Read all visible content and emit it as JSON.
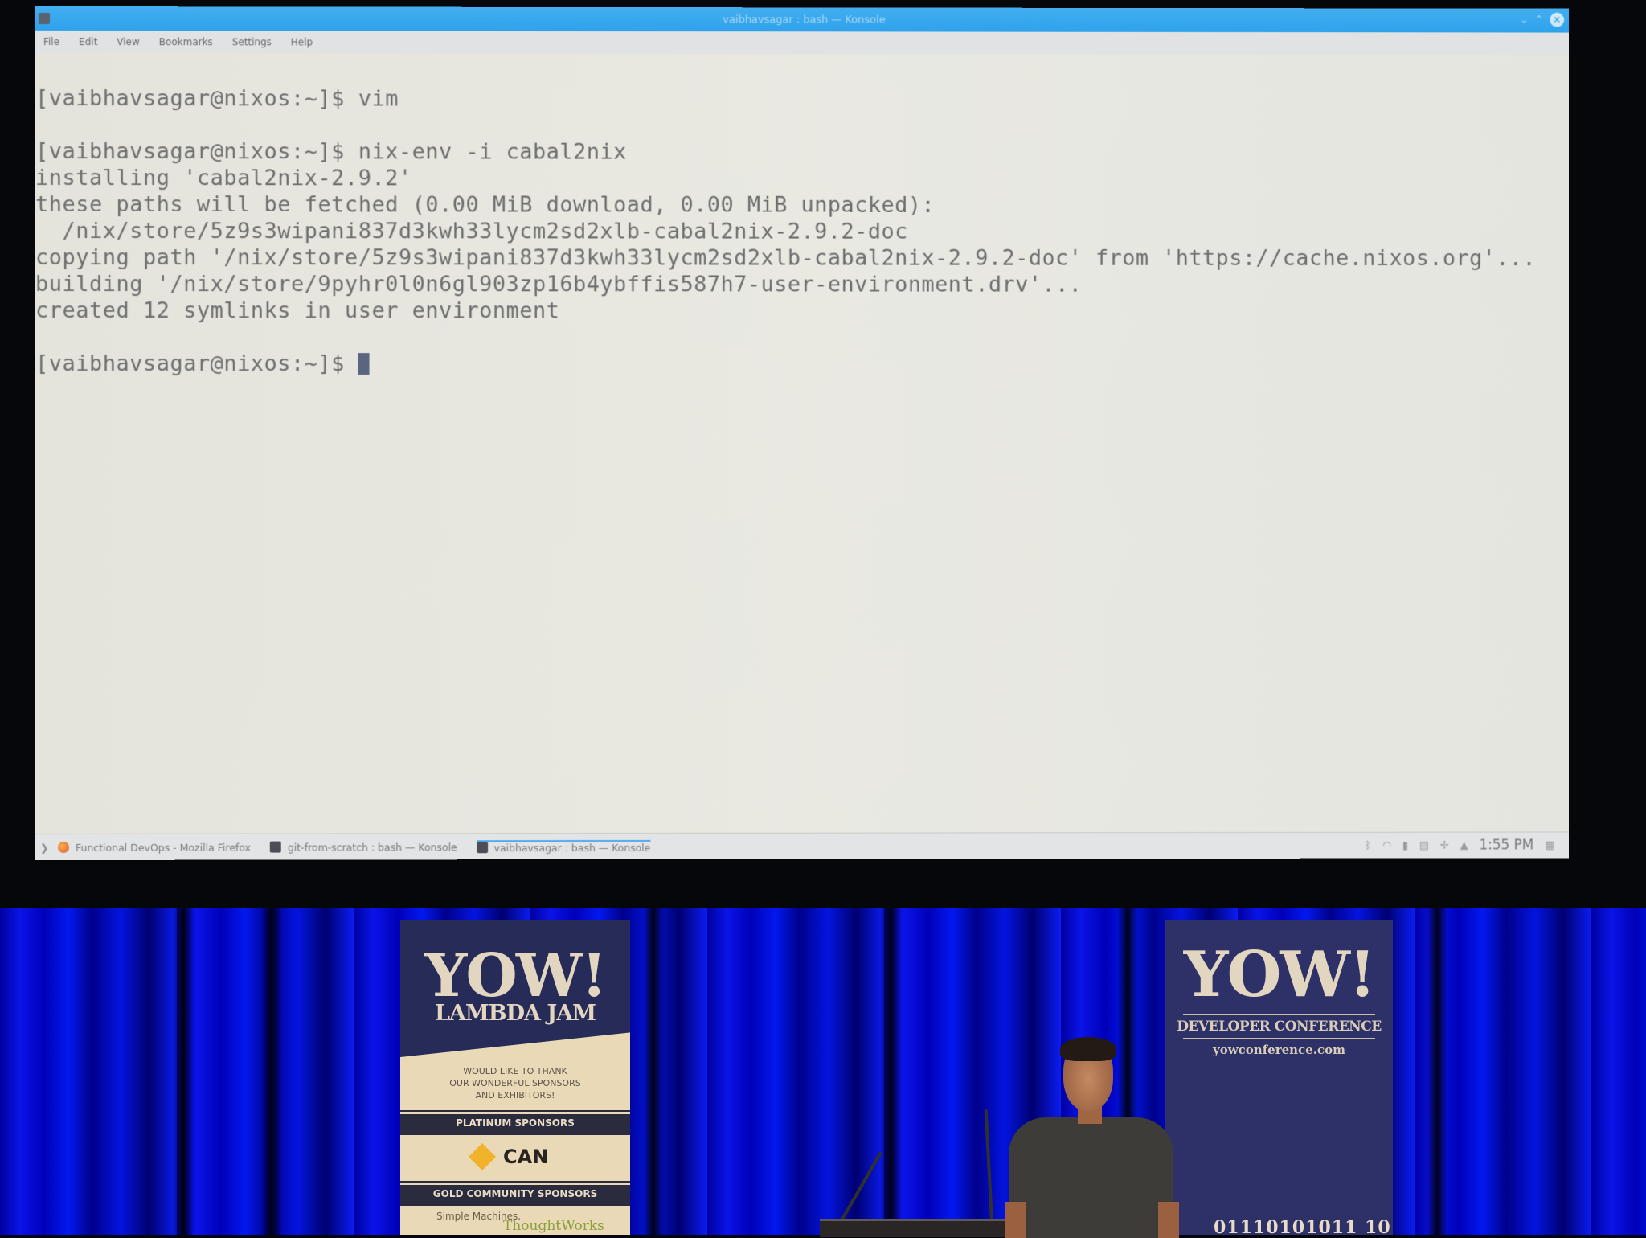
{
  "window": {
    "title": "vaibhavsagar : bash — Konsole",
    "controls": {
      "minimize": "⌄",
      "maximize": "⌃",
      "close": "✕"
    }
  },
  "menubar": {
    "items": [
      {
        "label": "File"
      },
      {
        "label": "Edit"
      },
      {
        "label": "View"
      },
      {
        "label": "Bookmarks"
      },
      {
        "label": "Settings"
      },
      {
        "label": "Help"
      }
    ]
  },
  "terminal": {
    "lines": [
      "[vaibhavsagar@nixos:~]$ vim",
      "",
      "[vaibhavsagar@nixos:~]$ nix-env -i cabal2nix",
      "installing 'cabal2nix-2.9.2'",
      "these paths will be fetched (0.00 MiB download, 0.00 MiB unpacked):",
      "  /nix/store/5z9s3wipani837d3kwh33lycm2sd2xlb-cabal2nix-2.9.2-doc",
      "copying path '/nix/store/5z9s3wipani837d3kwh33lycm2sd2xlb-cabal2nix-2.9.2-doc' from 'https://cache.nixos.org'...",
      "building '/nix/store/9pyhr0l0n6gl903zp16b4ybffis587h7-user-environment.drv'...",
      "created 12 symlinks in user environment",
      "",
      "[vaibhavsagar@nixos:~]$ "
    ]
  },
  "taskbar": {
    "launcher_icon": "application-launcher-icon",
    "tasks": [
      {
        "label": "Functional DevOps - Mozilla Firefox",
        "icon": "firefox-icon",
        "active": false
      },
      {
        "label": "git-from-scratch : bash — Konsole",
        "icon": "konsole-icon",
        "active": false
      },
      {
        "label": "vaibhavsagar : bash — Konsole",
        "icon": "konsole-icon",
        "active": true
      }
    ],
    "tray": {
      "icons": [
        "bluetooth-icon",
        "wifi-icon",
        "battery-icon",
        "clipboard-icon",
        "volume-icon",
        "expand-tray-icon"
      ],
      "clock": "1:55 PM"
    }
  },
  "stage": {
    "left_banner": {
      "title": "YOW!",
      "subtitle": "LAMBDA JAM",
      "thanks": [
        "WOULD LIKE TO THANK",
        "OUR WONDERFUL SPONSORS",
        "AND EXHIBITORS!"
      ],
      "platinum_heading": "PLATINUM SPONSORS",
      "platinum_sponsor": "CAN",
      "gold_heading": "GOLD COMMUNITY SPONSORS",
      "gold_sponsors": [
        "Simple Machines.",
        "ThoughtWorks"
      ]
    },
    "right_banner": {
      "title": "YOW!",
      "subtitle": "DEVELOPER CONFERENCE",
      "url": "yowconference.com",
      "binary": "01110101011 10"
    }
  },
  "colors": {
    "titlebar": "#2ea2ec",
    "terminal_bg": "#e6e6e0",
    "terminal_fg": "#6e6e6e",
    "curtain": "#0a14e8",
    "banner_navy": "#2d3070"
  }
}
